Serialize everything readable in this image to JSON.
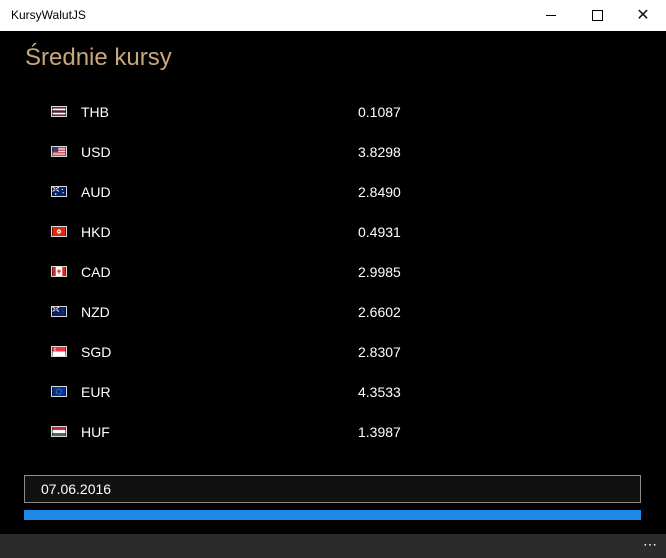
{
  "window": {
    "title": "KursyWalutJS"
  },
  "heading": "Średnie kursy",
  "rates": [
    {
      "code": "THB",
      "value": "0.1087",
      "flag": "thailand-flag-icon"
    },
    {
      "code": "USD",
      "value": "3.8298",
      "flag": "usa-flag-icon"
    },
    {
      "code": "AUD",
      "value": "2.8490",
      "flag": "australia-flag-icon"
    },
    {
      "code": "HKD",
      "value": "0.4931",
      "flag": "hong-kong-flag-icon"
    },
    {
      "code": "CAD",
      "value": "2.9985",
      "flag": "canada-flag-icon"
    },
    {
      "code": "NZD",
      "value": "2.6602",
      "flag": "new-zealand-flag-icon"
    },
    {
      "code": "SGD",
      "value": "2.8307",
      "flag": "singapore-flag-icon"
    },
    {
      "code": "EUR",
      "value": "4.3533",
      "flag": "eu-flag-icon"
    },
    {
      "code": "HUF",
      "value": "1.3987",
      "flag": "hungary-flag-icon"
    }
  ],
  "date_input": {
    "value": "07.06.2016"
  },
  "progress": {
    "value": 1.0,
    "color": "#1e88e5"
  },
  "app_bar": {
    "more_label": "⋯"
  },
  "colors": {
    "heading": "#c9a77d",
    "background": "#000000"
  }
}
